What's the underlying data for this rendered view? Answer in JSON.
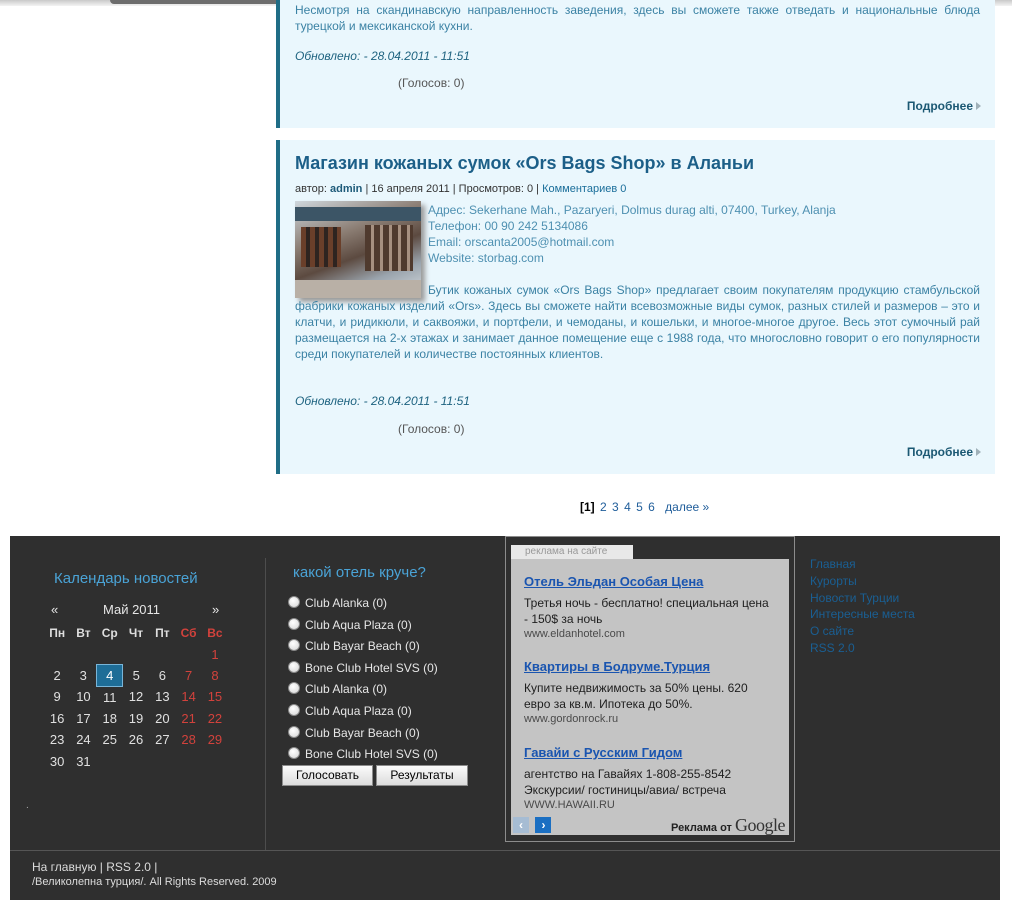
{
  "article1": {
    "snippet": "Несмотря на скандинавскую направленность заведения, здесь вы сможете также отведать и национальные блюда турецкой и мексиканской кухни.",
    "updated": "Обновлено: - 28.04.2011 - 11:51",
    "votes": "(Голосов: 0)",
    "more": "Подробнее"
  },
  "article2": {
    "title": "Магазин кожаных сумок «Ors Bags Shop» в Аланьи",
    "meta_prefix": "автор:",
    "author": "admin",
    "meta_middle": "| 16 апреля 2011 | Просмотров: 0 |",
    "comments": "Комментариев 0",
    "address": "Адрес: Sekerhane Mah., Pazaryeri, Dolmus durag alti, 07400, Turkey, Alanja",
    "phone": "Телефон: 00 90 242 5134086",
    "email": "Email: orscanta2005@hotmail.com",
    "website": "Website: storbag.com",
    "body": "Бутик кожаных сумок «Ors Bags Shop» предлагает своим покупателям продукцию стамбульской фабрики кожаных изделий «Ors». Здесь вы сможете найти всевозможные виды сумок, разных стилей и размеров – это и клатчи, и ридикюли, и саквояжи, и портфели, и чемоданы, и кошельки, и многое-многое другое. Весь этот сумочный рай размещается на 2-х этажах и занимает данное помещение еще с 1988 года, что многословно говорит о его популярности среди покупателей и количестве постоянных клиентов.",
    "updated": "Обновлено: - 28.04.2011 - 11:51",
    "votes": "(Голосов: 0)",
    "more": "Подробнее"
  },
  "pagination": {
    "current": "[1]",
    "pages": [
      "2",
      "3",
      "4",
      "5",
      "6"
    ],
    "next": "далее »"
  },
  "calendar": {
    "title": "Календарь новостей",
    "prev": "«",
    "month": "Май 2011",
    "next": "»",
    "weekdays": [
      "Пн",
      "Вт",
      "Ср",
      "Чт",
      "Пт",
      "Сб",
      "Вс"
    ],
    "weeks": [
      [
        "",
        "",
        "",
        "",
        "",
        "",
        "1"
      ],
      [
        "2",
        "3",
        "4",
        "5",
        "6",
        "7",
        "8"
      ],
      [
        "9",
        "10",
        "11",
        "12",
        "13",
        "14",
        "15"
      ],
      [
        "16",
        "17",
        "18",
        "19",
        "20",
        "21",
        "22"
      ],
      [
        "23",
        "24",
        "25",
        "26",
        "27",
        "28",
        "29"
      ],
      [
        "30",
        "31",
        "",
        "",
        "",
        "",
        ""
      ]
    ],
    "today": "4",
    "dot": "."
  },
  "poll": {
    "title": "какой отель круче?",
    "options": [
      "Club Alanka (0)",
      "Club Aqua Plaza (0)",
      "Club Bayar Beach (0)",
      "Bone Club Hotel SVS (0)",
      "Club Alanka (0)",
      "Club Aqua Plaza (0)",
      "Club Bayar Beach (0)",
      "Bone Club Hotel SVS (0)"
    ],
    "vote_label": "Голосовать",
    "results_label": "Результаты"
  },
  "ads": {
    "tab": "реклама на сайте",
    "items": [
      {
        "headline": "Отель Эльдан Особая Цена",
        "text": "Третья ночь - бесплатно! специальная цена - 150$ за ночь",
        "url": "www.eldanhotel.com"
      },
      {
        "headline": "Квартиры в Бодруме.Турция",
        "text": "Купите недвижимость за 50% цены. 620 евро за кв.м. Ипотека до 50%.",
        "url": "www.gordonrock.ru"
      },
      {
        "headline": "Гавайи с Русским Гидом",
        "text": "агентство на Гавайях 1-808-255-8542 Экскурсии/ гостиницы/авиа/ встреча",
        "url": "WWW.HAWAII.RU"
      }
    ],
    "ads_by": "Реклама от",
    "google": "Google"
  },
  "right_menu": [
    "Главная",
    "Курорты",
    "Новости Турции",
    "Интересные места",
    "О сайте",
    "RSS 2.0"
  ],
  "footer": {
    "home": "На главную",
    "rss": "RSS 2.0",
    "copyright": "/Великолепна турция/. All Rights Reserved. 2009"
  },
  "colors": {
    "accent": "#1f6d86",
    "card_bg": "#eaf7fd",
    "footer_bg": "#2f2f2f",
    "heading_blue": "#4aa3d6",
    "weekend_red": "#d2423c"
  }
}
